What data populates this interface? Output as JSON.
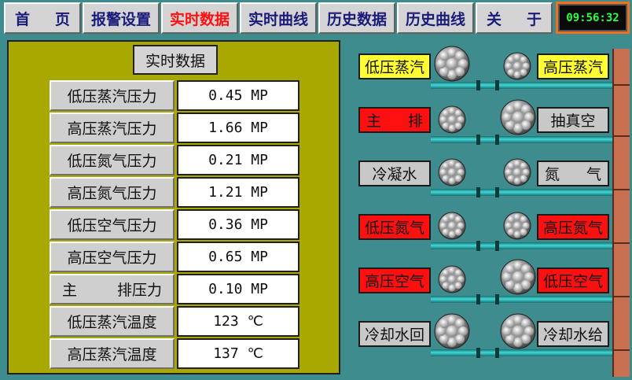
{
  "nav": {
    "home": [
      "首",
      "页"
    ],
    "alarm_settings": "报警设置",
    "realtime_data": "实时数据",
    "realtime_curve": "实时曲线",
    "history_data": "历史数据",
    "history_curve": "历史曲线",
    "about": [
      "关",
      "于"
    ]
  },
  "clock": "09:56:32",
  "panel": {
    "title": "实时数据",
    "rows": [
      {
        "label": "低压蒸汽压力",
        "value": "0.45 MP"
      },
      {
        "label": "高压蒸汽压力",
        "value": "1.66 MP"
      },
      {
        "label": "低压氮气压力",
        "value": "0.21 MP"
      },
      {
        "label": "高压氮气压力",
        "value": "1.21 MP"
      },
      {
        "label": "低压空气压力",
        "value": "0.36 MP"
      },
      {
        "label": "高压空气压力",
        "value": "0.65 MP"
      },
      {
        "label_parts": [
          "主",
          "排压力"
        ],
        "value": "0.10 MP"
      },
      {
        "label": "低压蒸汽温度",
        "value": "123 ℃"
      },
      {
        "label": "高压蒸汽温度",
        "value": "137 ℃"
      }
    ]
  },
  "diagram": {
    "rows": [
      {
        "left": "低压蒸汽",
        "right": "高压蒸汽"
      },
      {
        "left_parts": [
          "主",
          "排"
        ],
        "right": "抽真空"
      },
      {
        "left": "冷凝水",
        "right_parts": [
          "氮",
          "气"
        ]
      },
      {
        "left": "低压氮气",
        "right": "高压氮气"
      },
      {
        "left": "高压空气",
        "right": "低压空气"
      },
      {
        "left": "冷却水回",
        "right": "冷却水给"
      }
    ]
  },
  "colors": {
    "background": "#3f8c8f",
    "panel": "#a8a800",
    "active_nav_text": "#ff1010",
    "nav_text": "#1a1a7a",
    "alarm_red": "#ff1010",
    "normal_yellow": "#ffff33",
    "clock_digits": "#2cff3c"
  }
}
